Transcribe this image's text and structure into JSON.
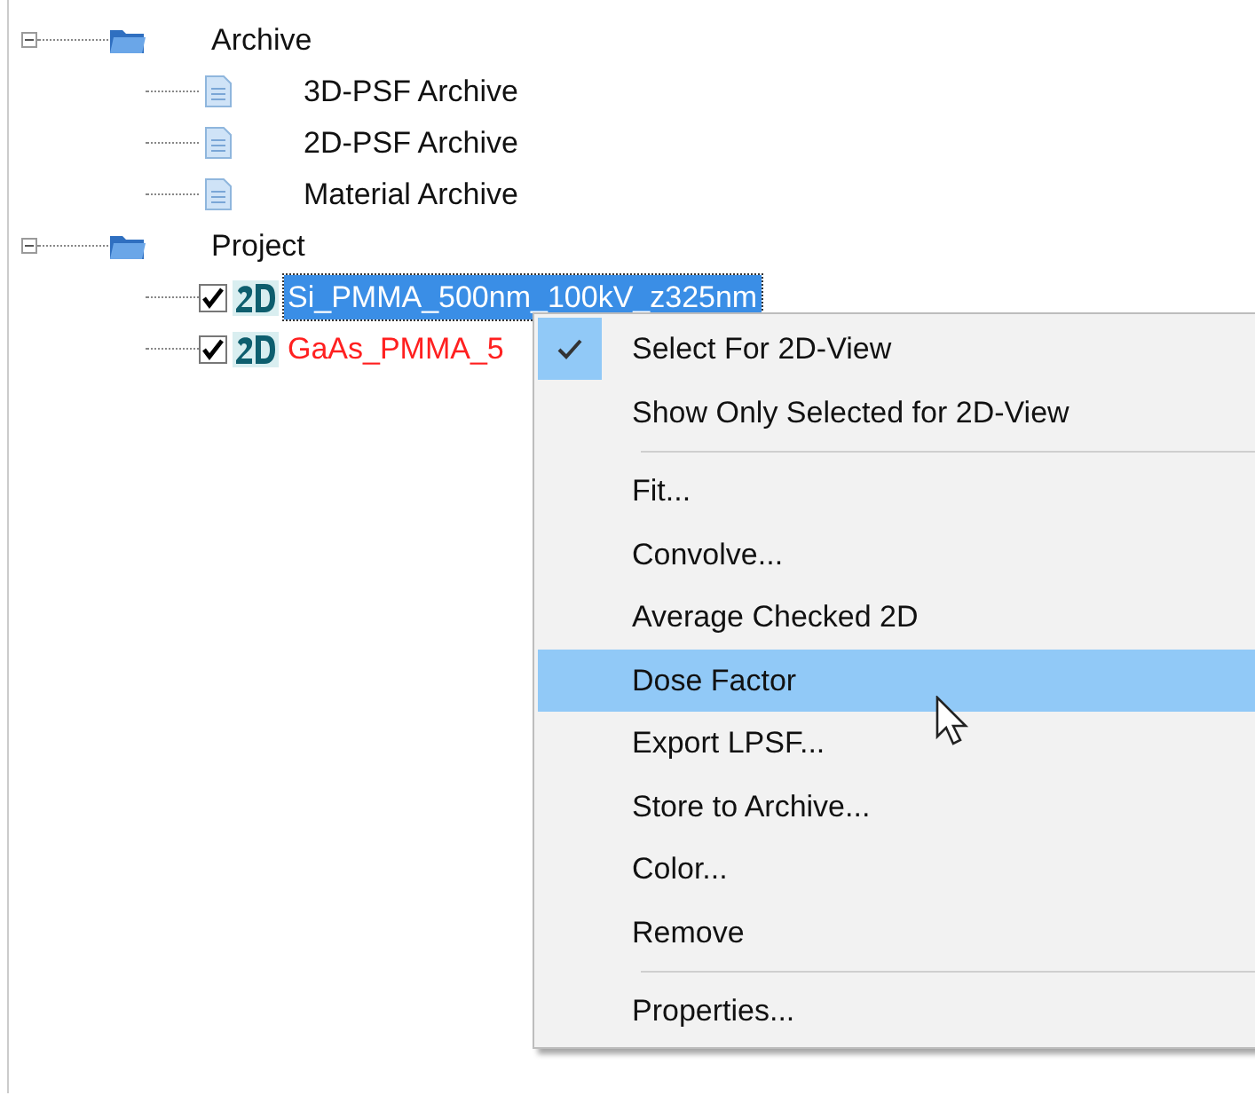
{
  "tree": [
    {
      "label": "Archive",
      "kind": "folder",
      "expanded": true,
      "children": [
        {
          "label": "3D-PSF Archive",
          "kind": "document"
        },
        {
          "label": "2D-PSF Archive",
          "kind": "document"
        },
        {
          "label": "Material Archive",
          "kind": "document"
        }
      ]
    },
    {
      "label": "Project",
      "kind": "folder",
      "expanded": true,
      "children": [
        {
          "label": "Si_PMMA_500nm_100kV_z325nm",
          "kind": "layer",
          "checked": true,
          "selected": true
        },
        {
          "label": "GaAs_PMMA_5",
          "kind": "layer",
          "checked": true,
          "selected": false,
          "color": "#ff2020"
        }
      ]
    }
  ],
  "context_menu": [
    {
      "kind": "item",
      "label": "Select For 2D-View",
      "checked": true,
      "selected": false
    },
    {
      "kind": "item",
      "label": "Show Only Selected for 2D-View",
      "checked": false,
      "selected": false
    },
    {
      "kind": "separator"
    },
    {
      "kind": "item",
      "label": "Fit...",
      "checked": false,
      "selected": false
    },
    {
      "kind": "item",
      "label": "Convolve...",
      "checked": false,
      "selected": false
    },
    {
      "kind": "item",
      "label": "Average Checked 2D",
      "checked": false,
      "selected": false
    },
    {
      "kind": "item",
      "label": "Dose Factor",
      "checked": false,
      "selected": true
    },
    {
      "kind": "item",
      "label": "Export LPSF...",
      "checked": false,
      "selected": false
    },
    {
      "kind": "item",
      "label": "Store to Archive...",
      "checked": false,
      "selected": false
    },
    {
      "kind": "item",
      "label": "Color...",
      "checked": false,
      "selected": false
    },
    {
      "kind": "item",
      "label": "Remove",
      "checked": false,
      "selected": false
    },
    {
      "kind": "separator"
    },
    {
      "kind": "item",
      "label": "Properties...",
      "checked": false,
      "selected": false
    }
  ]
}
